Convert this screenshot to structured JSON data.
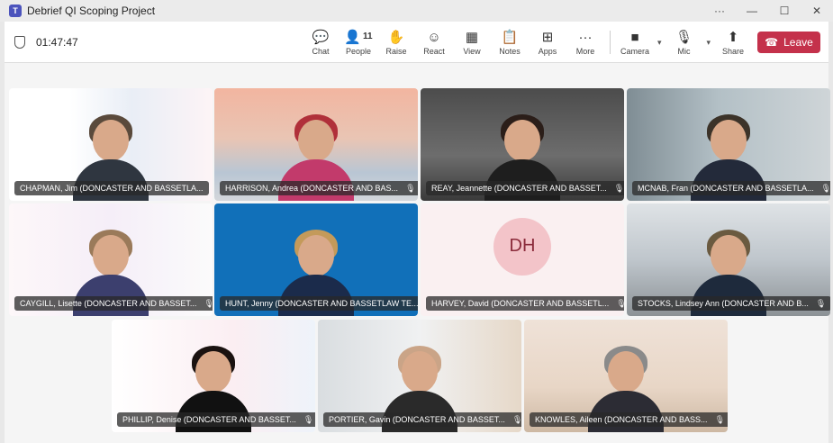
{
  "window": {
    "title": "Debrief QI Scoping Project",
    "controls": [
      "···",
      "—",
      "☐",
      "✕"
    ]
  },
  "toolbar": {
    "timer": "01:47:47",
    "tools": [
      {
        "name": "chat",
        "label": "Chat",
        "icon": "💬"
      },
      {
        "name": "people",
        "label": "People",
        "icon": "👤",
        "count": "11"
      },
      {
        "name": "raise",
        "label": "Raise",
        "icon": "✋"
      },
      {
        "name": "react",
        "label": "React",
        "icon": "☺"
      },
      {
        "name": "view",
        "label": "View",
        "icon": "▦"
      },
      {
        "name": "notes",
        "label": "Notes",
        "icon": "📋"
      },
      {
        "name": "apps",
        "label": "Apps",
        "icon": "⊞"
      },
      {
        "name": "more",
        "label": "More",
        "icon": "···"
      }
    ],
    "camera_label": "Camera",
    "mic_label": "Mic",
    "share_label": "Share",
    "leave_label": "Leave"
  },
  "participants": [
    {
      "name": "CHAPMAN, Jim (DONCASTER AND BASSETLA...",
      "mic": false
    },
    {
      "name": "HARRISON, Andrea (DONCASTER AND BAS...",
      "mic": true
    },
    {
      "name": "REAY, Jeannette (DONCASTER AND BASSET...",
      "mic": true
    },
    {
      "name": "MCNAB, Fran (DONCASTER AND BASSETLA...",
      "mic": true
    },
    {
      "name": "CAYGILL, Lisette (DONCASTER AND BASSET...",
      "mic": true
    },
    {
      "name": "HUNT, Jenny (DONCASTER AND BASSETLAW TE...",
      "mic": false
    },
    {
      "name": "HARVEY, David (DONCASTER AND BASSETL...",
      "mic": true,
      "initials": "DH"
    },
    {
      "name": "STOCKS, Lindsey Ann (DONCASTER AND B...",
      "mic": true
    },
    {
      "name": "PHILLIP, Denise (DONCASTER AND BASSET...",
      "mic": true
    },
    {
      "name": "PORTIER, Gavin (DONCASTER AND BASSET...",
      "mic": true
    },
    {
      "name": "KNOWLES, Aileen (DONCASTER AND BASS...",
      "mic": true
    }
  ]
}
